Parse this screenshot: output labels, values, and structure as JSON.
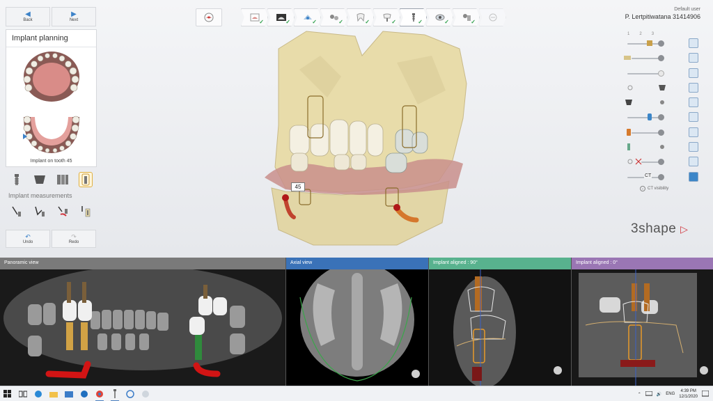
{
  "nav": {
    "back_label": "Back",
    "next_label": "Next"
  },
  "left_panel": {
    "title": "Implant planning",
    "caption": "Implant on tooth 45",
    "measurements_label": "Implant measurements",
    "undo_label": "Undo",
    "redo_label": "Redo"
  },
  "user": {
    "default_label": "Default user",
    "patient_name": "P. Lertpitiwatana 31414906"
  },
  "right_panel": {
    "view_numbers": [
      "1",
      "2",
      "3"
    ],
    "ct_label": "CT",
    "ct_visibility_label": "CT visibility"
  },
  "model": {
    "tooth_badge": "45"
  },
  "brand": {
    "name": "3shape"
  },
  "panels": {
    "panoramic": {
      "title": "Panoramic view",
      "color": "#7a7a7a"
    },
    "axial": {
      "title": "Axial view",
      "color": "#3a72b8"
    },
    "aligned90": {
      "title": "Implant aligned : 90°",
      "color": "#58b28e"
    },
    "aligned0": {
      "title": "Implant aligned : 0°",
      "color": "#9a76b4"
    }
  },
  "taskbar": {
    "language": "ENG",
    "time": "4:39 PM",
    "date": "12/1/2020"
  },
  "colors": {
    "accent": "#3c82c8",
    "check": "#2ea04a",
    "brand_mark": "#d0343c"
  }
}
